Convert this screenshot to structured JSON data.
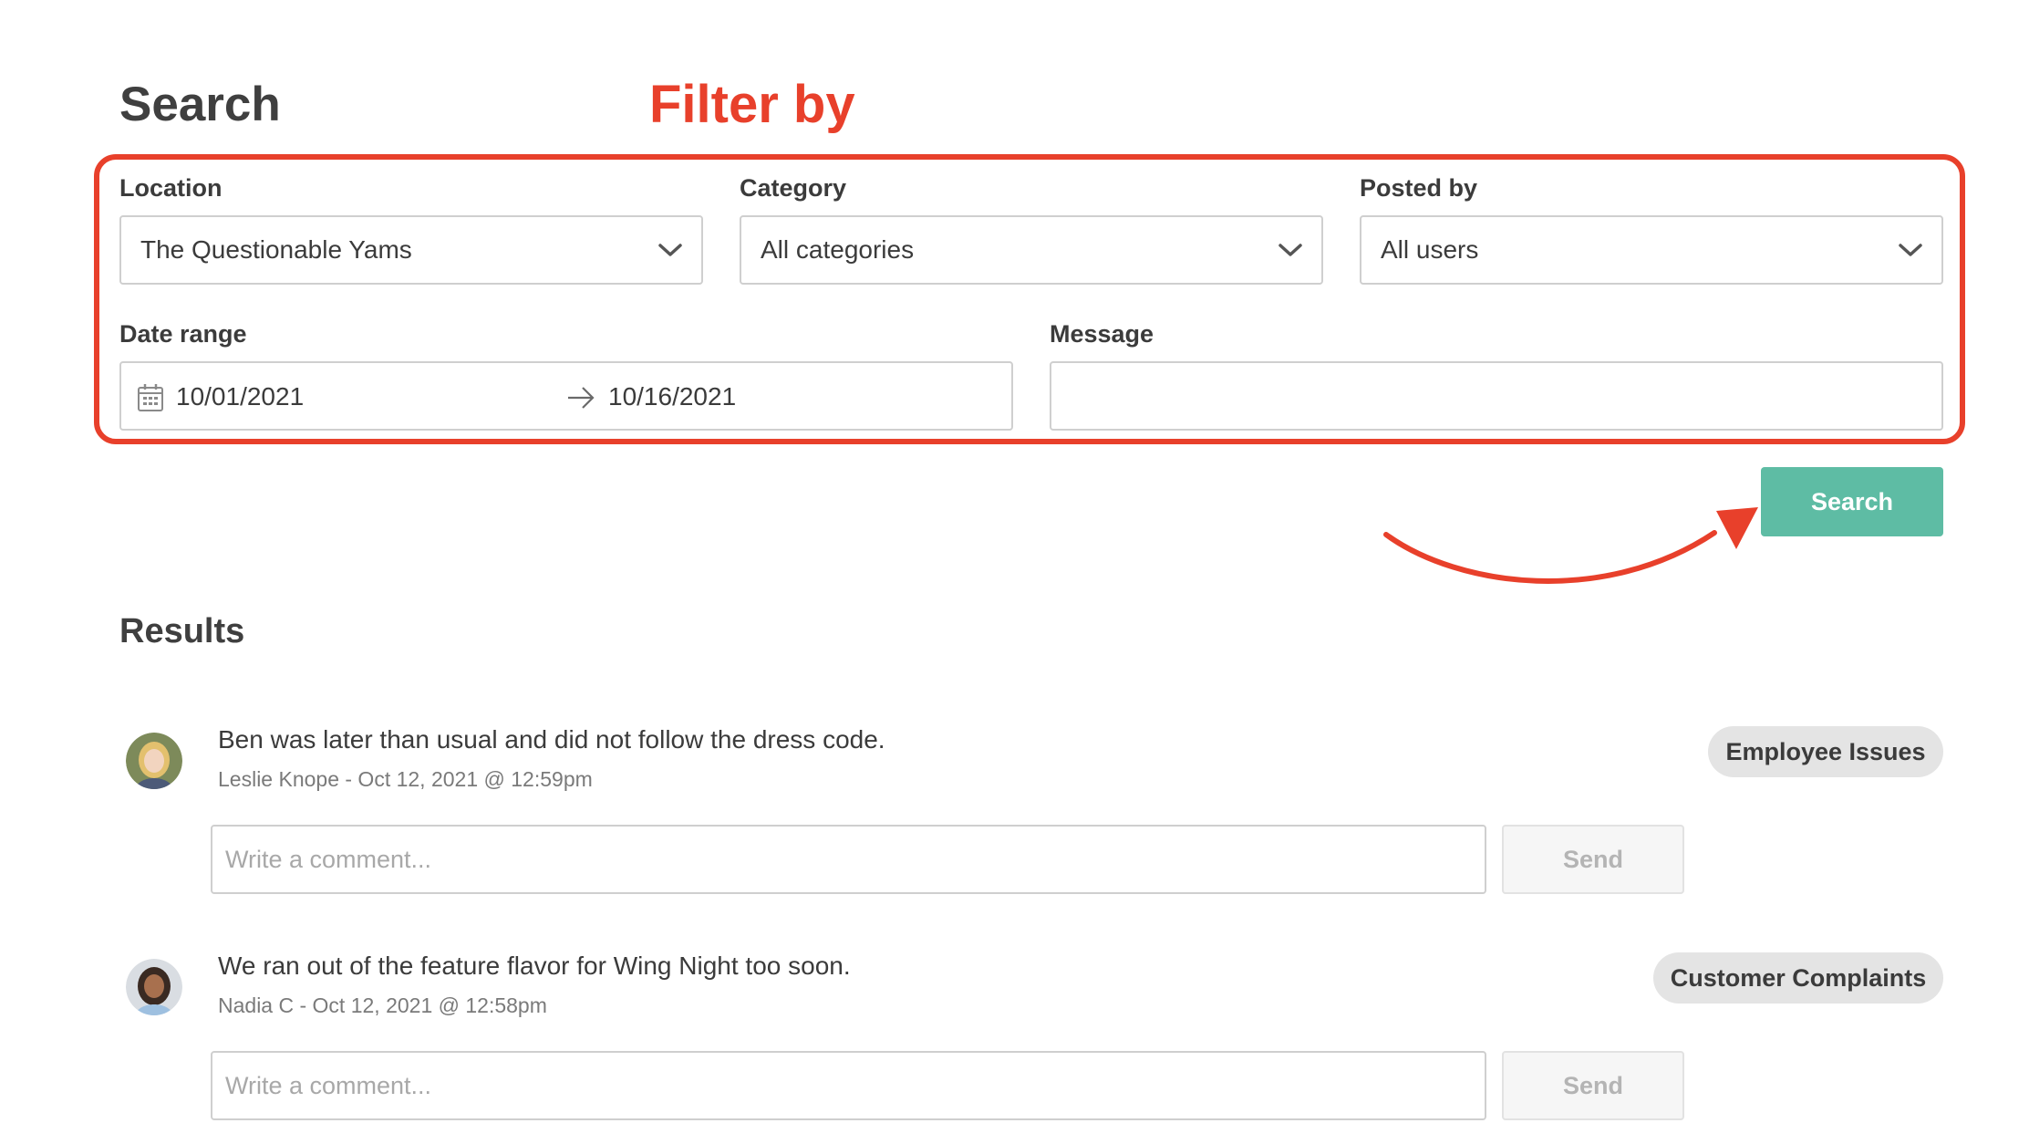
{
  "page": {
    "title": "Search",
    "annotation": "Filter by"
  },
  "filters": {
    "location": {
      "label": "Location",
      "value": "The Questionable Yams"
    },
    "category": {
      "label": "Category",
      "value": "All categories"
    },
    "posted_by": {
      "label": "Posted by",
      "value": "All users"
    },
    "date_range": {
      "label": "Date range",
      "start": "10/01/2021",
      "end": "10/16/2021"
    },
    "message": {
      "label": "Message",
      "value": ""
    }
  },
  "search_button": {
    "label": "Search"
  },
  "results": {
    "title": "Results",
    "items": [
      {
        "message": "Ben was later than usual and did not follow the dress code.",
        "meta": "Leslie Knope - Oct 12, 2021 @ 12:59pm",
        "category": "Employee Issues",
        "comment_placeholder": "Write a comment...",
        "send_label": "Send"
      },
      {
        "message": "We ran out of the feature flavor for Wing Night too soon.",
        "meta": "Nadia C - Oct 12, 2021 @ 12:58pm",
        "category": "Customer Complaints",
        "comment_placeholder": "Write a comment...",
        "send_label": "Send"
      }
    ]
  },
  "colors": {
    "accent": "#5ebca4",
    "annotation": "#e8402b",
    "badge_bg": "#e4e4e4",
    "border": "#cfcfcf"
  },
  "icons": {
    "select": "chevron-down-icon",
    "date": "calendar-icon",
    "range": "arrow-right-icon",
    "annotation": "curved-arrow-icon"
  }
}
